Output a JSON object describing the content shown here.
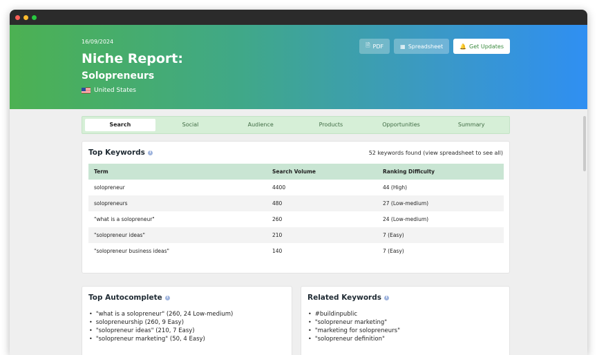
{
  "hero": {
    "date": "16/09/2024",
    "title": "Niche Report:",
    "subtitle": "Solopreneurs",
    "country": "United States",
    "buttons": {
      "pdf": "PDF",
      "spreadsheet": "Spreadsheet",
      "updates": "Get Updates"
    }
  },
  "tabs": [
    "Search",
    "Social",
    "Audience",
    "Products",
    "Opportunities",
    "Summary"
  ],
  "top_keywords": {
    "title": "Top Keywords",
    "found": "52 keywords found (view spreadsheet to see all)",
    "columns": [
      "Term",
      "Search Volume",
      "Ranking Difficulty"
    ],
    "rows": [
      [
        "solopreneur",
        "4400",
        "44 (High)"
      ],
      [
        "solopreneurs",
        "480",
        "27 (Low-medium)"
      ],
      [
        "\"what is a solopreneur\"",
        "260",
        "24 (Low-medium)"
      ],
      [
        "\"solopreneur ideas\"",
        "210",
        "7 (Easy)"
      ],
      [
        "\"solopreneur business ideas\"",
        "140",
        "7 (Easy)"
      ]
    ]
  },
  "top_autocomplete": {
    "title": "Top Autocomplete",
    "items": [
      "\"what is a solopreneur\" (260, 24 Low-medium)",
      "solopreneurship (260, 9 Easy)",
      "\"solopreneur ideas\" (210, 7 Easy)",
      "\"solopreneur marketing\" (50, 4 Easy)"
    ]
  },
  "related_keywords": {
    "title": "Related Keywords",
    "items": [
      "#buildinpublic",
      "\"solopreneur marketing\"",
      "\"marketing for solopreneurs\"",
      "\"solopreneur definition\""
    ]
  },
  "colors": {
    "gradient_start": "#4cb152",
    "gradient_end": "#2f8ff2",
    "tab_bg": "#d6efd7",
    "table_header": "#c9e5d3"
  },
  "icons": {
    "pdf": "document-icon",
    "spreadsheet": "table-icon",
    "updates": "bell-icon",
    "info": "info-icon",
    "flag": "us-flag-icon"
  }
}
